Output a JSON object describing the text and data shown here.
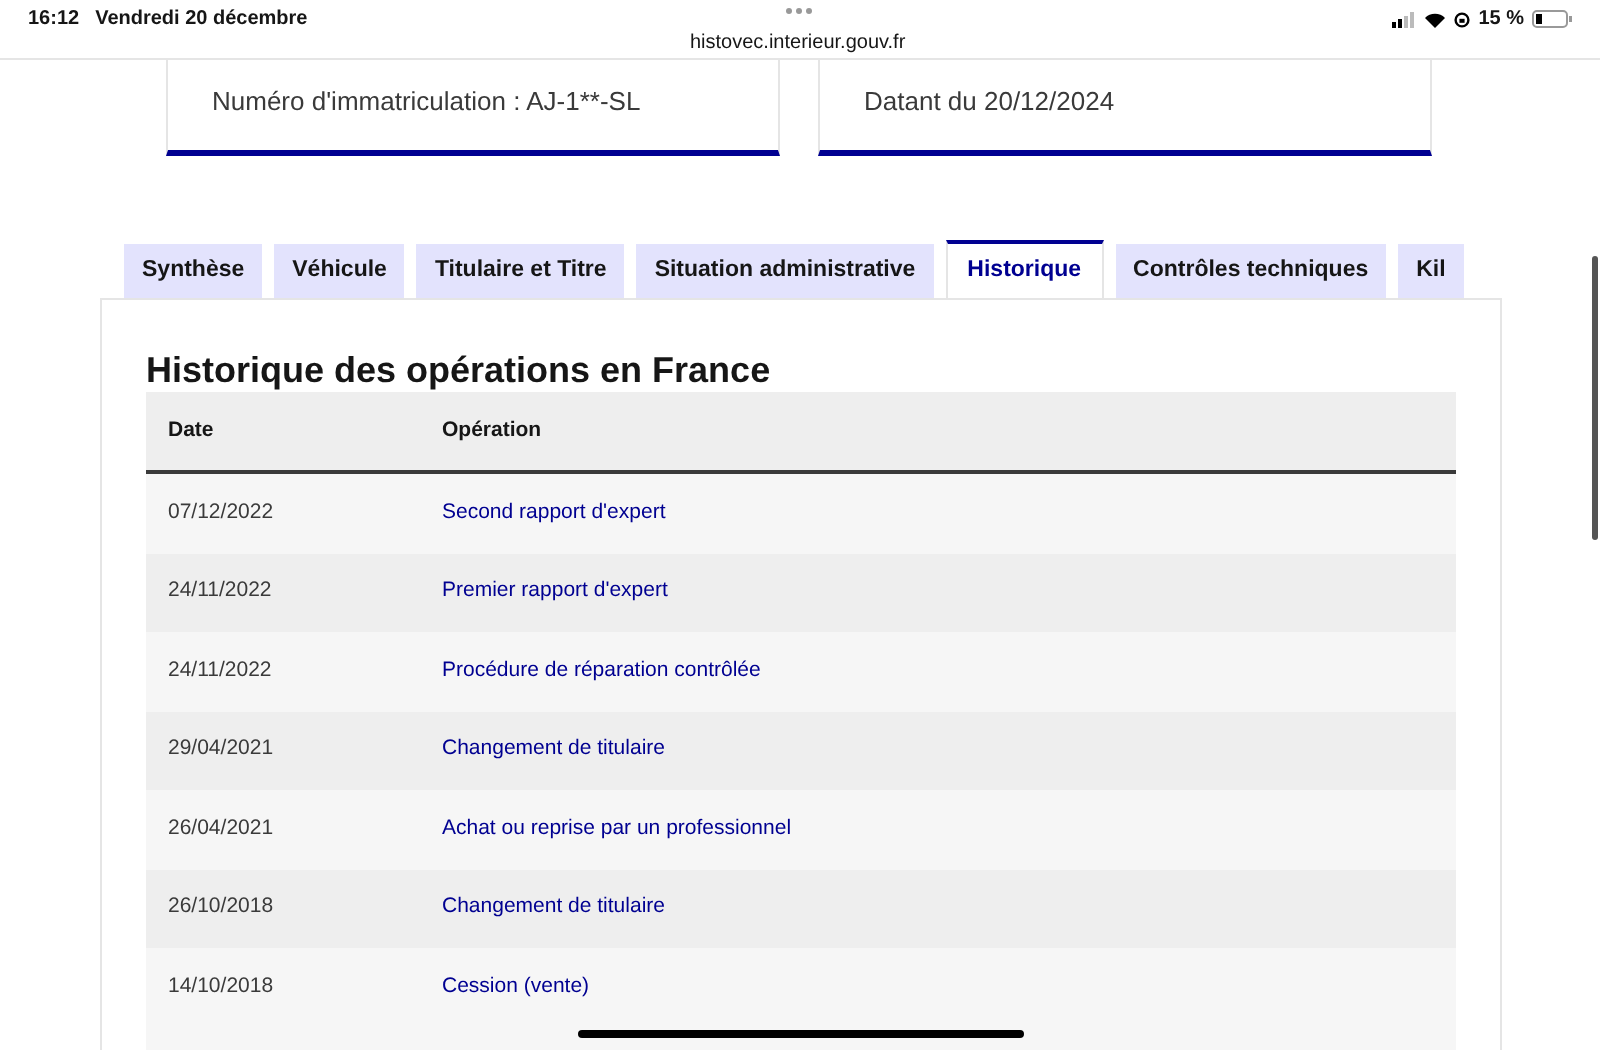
{
  "status_bar": {
    "time": "16:12",
    "date": "Vendredi 20 décembre",
    "url": "histovec.interieur.gouv.fr",
    "battery": "15 %"
  },
  "cards": [
    {
      "text": "Numéro d'immatriculation : AJ-1**-SL"
    },
    {
      "text": "Datant du 20/12/2024"
    }
  ],
  "tabs": [
    {
      "label": "Synthèse",
      "selected": false
    },
    {
      "label": "Véhicule",
      "selected": false
    },
    {
      "label": "Titulaire et Titre",
      "selected": false
    },
    {
      "label": "Situation administrative",
      "selected": false
    },
    {
      "label": "Historique",
      "selected": true
    },
    {
      "label": "Contrôles techniques",
      "selected": false
    },
    {
      "label": "Kil",
      "selected": false
    }
  ],
  "section": {
    "title": "Historique des opérations en France"
  },
  "table": {
    "columns": [
      "Date",
      "Opération"
    ],
    "rows": [
      {
        "date": "07/12/2022",
        "operation": "Second rapport d'expert"
      },
      {
        "date": "24/11/2022",
        "operation": "Premier rapport d'expert"
      },
      {
        "date": "24/11/2022",
        "operation": "Procédure de réparation contrôlée"
      },
      {
        "date": "29/04/2021",
        "operation": "Changement de titulaire"
      },
      {
        "date": "26/04/2021",
        "operation": "Achat ou reprise par un professionnel"
      },
      {
        "date": "26/10/2018",
        "operation": "Changement de titulaire"
      },
      {
        "date": "14/10/2018",
        "operation": "Cession (vente)"
      }
    ]
  }
}
